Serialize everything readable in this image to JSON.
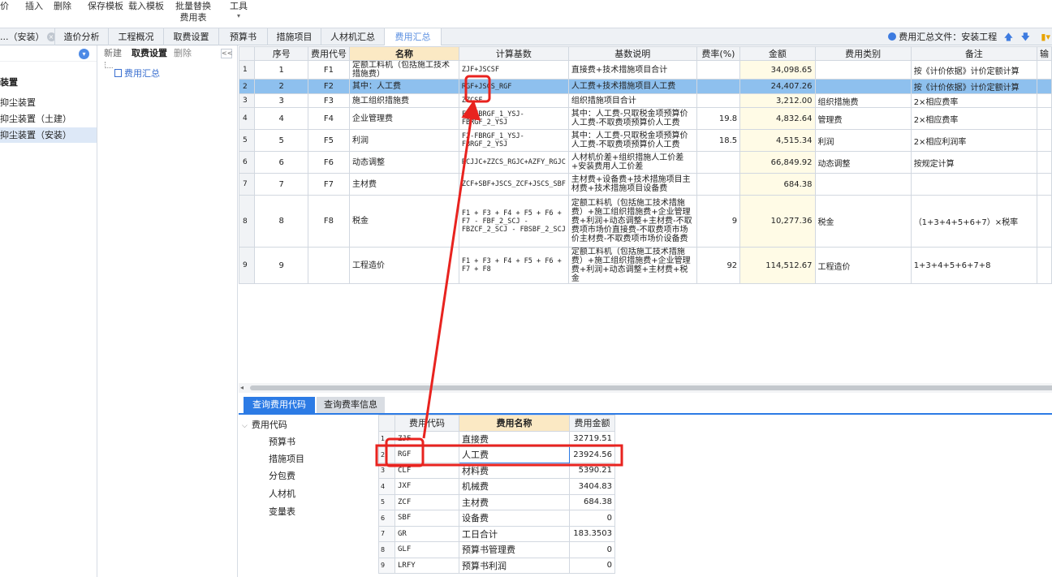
{
  "toolbar": {
    "items": [
      {
        "label": "价"
      },
      {
        "label": "插入"
      },
      {
        "label": "删除"
      },
      {
        "label": "保存模板"
      },
      {
        "label": "载入模板"
      },
      {
        "label": "批量替换",
        "label2": "费用表"
      },
      {
        "label": "工具"
      }
    ]
  },
  "tabs": {
    "items": [
      {
        "label": "...（安装）"
      },
      {
        "label": "造价分析"
      },
      {
        "label": "工程概况"
      },
      {
        "label": "取费设置"
      },
      {
        "label": "预算书"
      },
      {
        "label": "措施项目"
      },
      {
        "label": "人材机汇总"
      },
      {
        "label": "费用汇总"
      }
    ],
    "right_info": "费用汇总文件：安装工程"
  },
  "left_panel": {
    "title": "装置",
    "items": [
      "抑尘装置",
      "抑尘装置（土建）",
      "抑尘装置（安装）"
    ]
  },
  "mid_panel": {
    "new_label": "新建",
    "fee_setting_label": "取费设置",
    "delete_label": "删除",
    "collapse_label": "<<",
    "node_label": "费用汇总"
  },
  "main_table": {
    "headers": [
      "",
      "序号",
      "费用代号",
      "名称",
      "计算基数",
      "基数说明",
      "费率(%)",
      "金额",
      "费用类别",
      "备注",
      "输"
    ],
    "rows": [
      {
        "n": "1",
        "seq": "1",
        "code": "F1",
        "name": "定额工料机（包括施工技术措施费）",
        "base": "ZJF+JSCSF",
        "desc": "直接费+技术措施项目合计",
        "rate": "",
        "amount": "34,098.65",
        "cat": "",
        "note": "按《计价依据》计价定额计算"
      },
      {
        "n": "2",
        "seq": "2",
        "code": "F2",
        "name": "其中：人工费",
        "base": "RGF+JSCS_RGF",
        "desc": "人工费+技术措施项目人工费",
        "rate": "",
        "amount": "24,407.26",
        "cat": "",
        "note": "按《计价依据》计价定额计算"
      },
      {
        "n": "3",
        "seq": "3",
        "code": "F3",
        "name": "施工组织措施费",
        "base": "ZZCSF",
        "desc": "组织措施项目合计",
        "rate": "",
        "amount": "3,212.00",
        "cat": "组织措施费",
        "note": "2×相应费率"
      },
      {
        "n": "4",
        "seq": "4",
        "code": "F4",
        "name": "企业管理费",
        "base": "F2-FBRGF_1_YSJ-FBRGF_2_YSJ",
        "desc": "其中：人工费-只取税金项预算价人工费-不取费项预算价人工费",
        "rate": "19.8",
        "amount": "4,832.64",
        "cat": "管理费",
        "note": "2×相应费率"
      },
      {
        "n": "5",
        "seq": "5",
        "code": "F5",
        "name": "利润",
        "base": "F2-FBRGF_1_YSJ-FBRGF_2_YSJ",
        "desc": "其中：人工费-只取税金项预算价人工费-不取费项预算价人工费",
        "rate": "18.5",
        "amount": "4,515.34",
        "cat": "利润",
        "note": "2×相应利润率"
      },
      {
        "n": "6",
        "seq": "6",
        "code": "F6",
        "name": "动态调整",
        "base": "RCJJC+ZZCS_RGJC+AZFY_RGJC",
        "desc": "人材机价差+组织措施人工价差+安装费用人工价差",
        "rate": "",
        "amount": "66,849.92",
        "cat": "动态调整",
        "note": "按规定计算"
      },
      {
        "n": "7",
        "seq": "7",
        "code": "F7",
        "name": "主材费",
        "base": "ZCF+SBF+JSCS_ZCF+JSCS_SBF",
        "desc": "主材费+设备费+技术措施项目主材费+技术措施项目设备费",
        "rate": "",
        "amount": "684.38",
        "cat": "",
        "note": ""
      },
      {
        "n": "8",
        "seq": "8",
        "code": "F8",
        "name": "税金",
        "base": "F1 + F3 + F4 + F5 + F6 + F7 - FBF_2_SCJ - FBZCF_2_SCJ - FBSBF_2_SCJ",
        "desc": "定额工料机（包括施工技术措施费）+施工组织措施费+企业管理费+利润+动态调整+主材费-不取费项市场价直接费-不取费项市场价主材费-不取费项市场价设备费",
        "rate": "9",
        "amount": "10,277.36",
        "cat": "税金",
        "note": "（1+3+4+5+6+7）×税率"
      },
      {
        "n": "9",
        "seq": "9",
        "code": "",
        "name": "工程造价",
        "base": "F1 + F3 + F4 + F5 + F6 + F7 + F8",
        "desc": "定额工料机（包括施工技术措施费）+施工组织措施费+企业管理费+利润+动态调整+主材费+税金",
        "rate": "92",
        "amount": "114,512.67",
        "cat": "工程造价",
        "note": "1+3+4+5+6+7+8"
      }
    ]
  },
  "bottom_tabs": {
    "query_code": "查询费用代码",
    "query_rate": "查询费率信息"
  },
  "code_tree": {
    "root": "费用代码",
    "items": [
      "预算书",
      "措施项目",
      "分包费",
      "人材机",
      "变量表"
    ]
  },
  "code_table": {
    "headers": [
      "",
      "费用代码",
      "费用名称",
      "费用金额"
    ],
    "rows": [
      {
        "n": "1",
        "code": "ZJF",
        "name": "直接费",
        "amount": "32719.51"
      },
      {
        "n": "2",
        "code": "RGF",
        "name": "人工费",
        "amount": "23924.56"
      },
      {
        "n": "3",
        "code": "CLF",
        "name": "材料费",
        "amount": "5390.21"
      },
      {
        "n": "4",
        "code": "JXF",
        "name": "机械费",
        "amount": "3404.83"
      },
      {
        "n": "5",
        "code": "ZCF",
        "name": "主材费",
        "amount": "684.38"
      },
      {
        "n": "6",
        "code": "SBF",
        "name": "设备费",
        "amount": "0"
      },
      {
        "n": "7",
        "code": "GR",
        "name": "工日合计",
        "amount": "183.3503"
      },
      {
        "n": "8",
        "code": "GLF",
        "name": "预算书管理费",
        "amount": "0"
      },
      {
        "n": "9",
        "code": "LRFY",
        "name": "预算书利润",
        "amount": "0"
      }
    ]
  },
  "colors": {
    "accent": "#2c7be5",
    "selected_row": "#8ec0ee",
    "annotation_red": "#e8231f",
    "header_highlight": "#fbe9c4"
  }
}
